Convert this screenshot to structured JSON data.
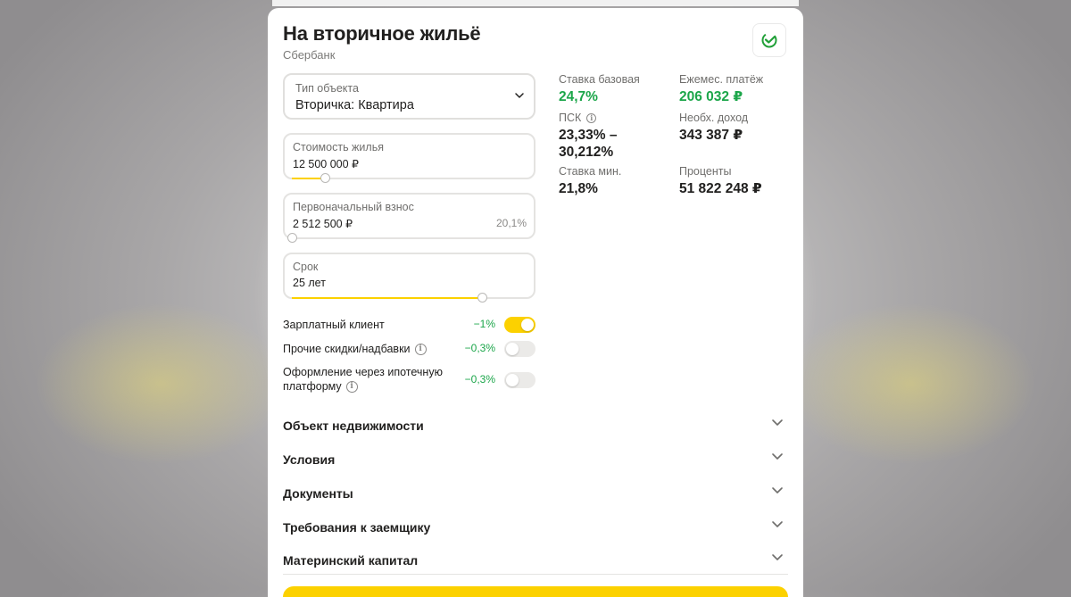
{
  "header": {
    "title": "На вторичное жильё",
    "bank": "Сбербанк",
    "logo_icon": "sber-logo-icon"
  },
  "form": {
    "object_type": {
      "label": "Тип объекта",
      "value": "Вторичка: Квартира"
    },
    "price": {
      "label": "Стоимость жилья",
      "value": "12 500 000 ₽",
      "slider_fraction": 0.14
    },
    "down_payment": {
      "label": "Первоначальный взнос",
      "value": "2 512 500 ₽",
      "percent": "20,1%",
      "slider_fraction": 0.0
    },
    "term": {
      "label": "Срок",
      "value": "25 лет",
      "slider_fraction": 0.81
    }
  },
  "stats": {
    "base_rate": {
      "label": "Ставка базовая",
      "value": "24,7%"
    },
    "monthly": {
      "label": "Ежемес. платёж",
      "value": "206 032 ₽"
    },
    "psk": {
      "label": "ПСК",
      "value_line1": "23,33% –",
      "value_line2": "30,212%"
    },
    "income": {
      "label": "Необх. доход",
      "value": "343 387 ₽"
    },
    "min_rate": {
      "label": "Ставка мин.",
      "value": "21,8%"
    },
    "interest": {
      "label": "Проценты",
      "value": "51 822 248 ₽"
    }
  },
  "options": [
    {
      "label": "Зарплатный клиент",
      "discount": "−1%",
      "on": true
    },
    {
      "label": "Прочие скидки/надбавки",
      "discount": "−0,3%",
      "on": false
    },
    {
      "label_line1": "Оформление через ипотечную",
      "label_line2": "платформу",
      "discount": "−0,3%",
      "on": false
    }
  ],
  "sections": [
    "Объект недвижимости",
    "Условия",
    "Документы",
    "Требования к заемщику",
    "Материнский капитал"
  ],
  "colors": {
    "accent_yellow": "#fcd100",
    "green": "#1ca64a",
    "text": "#21201f",
    "muted": "#6f6e6c"
  }
}
